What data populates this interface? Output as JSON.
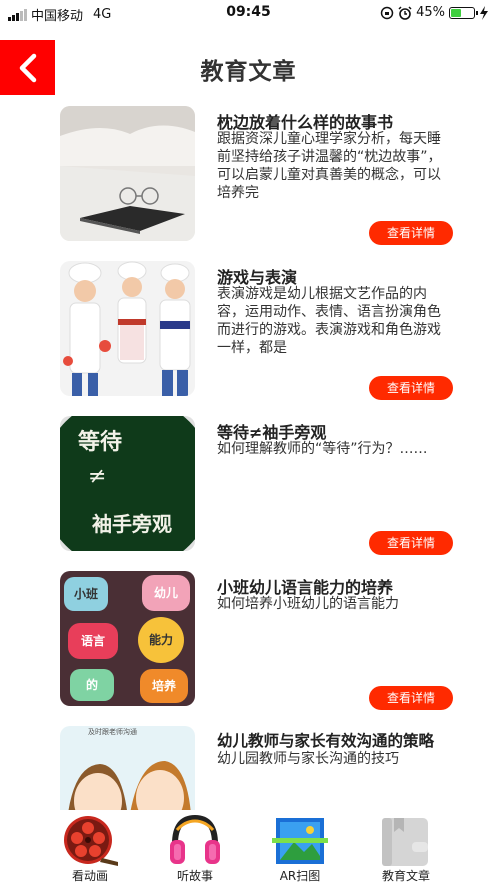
{
  "status_bar": {
    "carrier": "中国移动",
    "network": "4G",
    "time": "09:45",
    "battery": "45%",
    "battery_level": 0.45
  },
  "header": {
    "title": "教育文章"
  },
  "articles": [
    {
      "title": "枕边放着什么样的故事书",
      "description": "跟据资深儿童心理学家分析，每天睡前坚持给孩子讲温馨的“枕边故事”，可以启蒙儿童对真善美的概念，可以培养完",
      "button": "查看详情"
    },
    {
      "title": "游戏与表演",
      "description": "表演游戏是幼儿根据文艺作品的内容，运用动作、表情、语言扮演角色而进行的游戏。表演游戏和角色游戏一样，都是",
      "button": "查看详情"
    },
    {
      "title": "等待≠袖手旁观",
      "description": "如何理解教师的“等待”行为？……",
      "button": "查看详情",
      "thumb_text_top": "等待",
      "thumb_text_mid": "≠",
      "thumb_text_bottom": "袖手旁观"
    },
    {
      "title": "小班幼儿语言能力的培养",
      "description": "如何培养小班幼儿的语言能力",
      "button": "查看详情",
      "thumb_words": [
        "小班",
        "幼儿",
        "语言",
        "能力",
        "的",
        "培养"
      ]
    },
    {
      "title": "幼儿教师与家长有效沟通的策略",
      "description": "幼儿园教师与家长沟通的技巧",
      "thumb_caption": "及时跟老师沟通"
    }
  ],
  "tabs": [
    {
      "label": "看动画",
      "icon": "film-reel-icon"
    },
    {
      "label": "听故事",
      "icon": "headphones-icon"
    },
    {
      "label": "AR扫图",
      "icon": "ar-scan-icon"
    },
    {
      "label": "教育文章",
      "icon": "book-icon"
    }
  ],
  "colors": {
    "accent": "#ff2a00",
    "back_button": "#ff0000"
  }
}
